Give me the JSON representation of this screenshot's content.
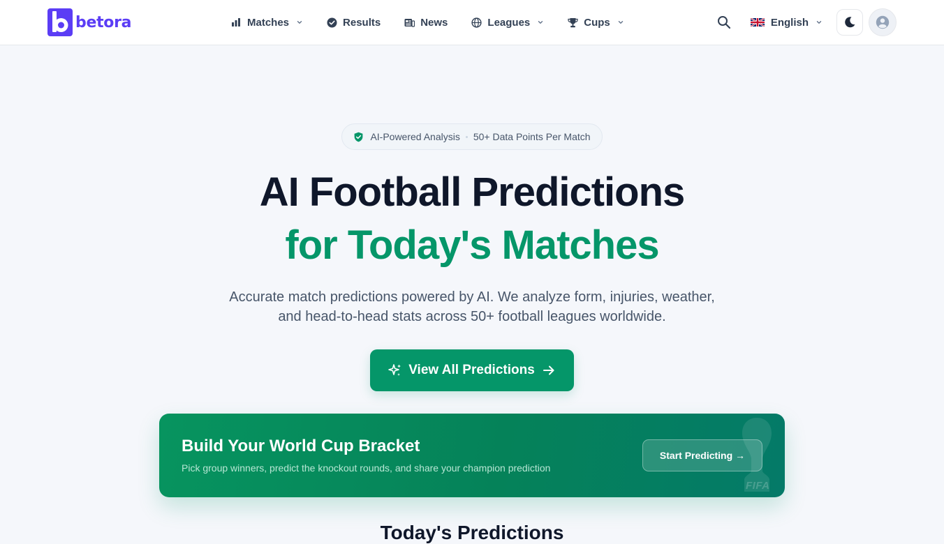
{
  "brand": {
    "name": "betora",
    "color": "#5b3df5"
  },
  "nav": {
    "items": [
      {
        "label": "Matches",
        "icon": "bar-chart-icon",
        "has_dropdown": true
      },
      {
        "label": "Results",
        "icon": "check-circle-icon",
        "has_dropdown": false
      },
      {
        "label": "News",
        "icon": "newspaper-icon",
        "has_dropdown": false
      },
      {
        "label": "Leagues",
        "icon": "globe-icon",
        "has_dropdown": true
      },
      {
        "label": "Cups",
        "icon": "trophy-icon",
        "has_dropdown": true
      }
    ]
  },
  "header": {
    "language": "English",
    "language_flag": "uk-flag-icon",
    "search_icon": "search-icon",
    "theme_icon": "moon-icon",
    "account_icon": "user-circle-icon"
  },
  "hero": {
    "badge_primary": "AI-Powered Analysis",
    "badge_secondary": "50+ Data Points Per Match",
    "title": "AI Football Predictions",
    "title_accent": "for Today's Matches",
    "subtitle": "Accurate match predictions powered by AI. We analyze form, injuries, weather, and head-to-head stats across 50+ football leagues worldwide.",
    "cta_label": "View All Predictions"
  },
  "banner": {
    "title": "Build Your World Cup Bracket",
    "subtitle": "Pick group winners, predict the knockout rounds, and share your champion prediction",
    "button_label": "Start Predicting →",
    "deco_text": "FIFA"
  },
  "section": {
    "next_heading": "Today's Predictions"
  },
  "colors": {
    "accent": "#059669",
    "text_dark": "#0f172a",
    "text_muted": "#475569",
    "page_bg": "#f5f7fb"
  }
}
